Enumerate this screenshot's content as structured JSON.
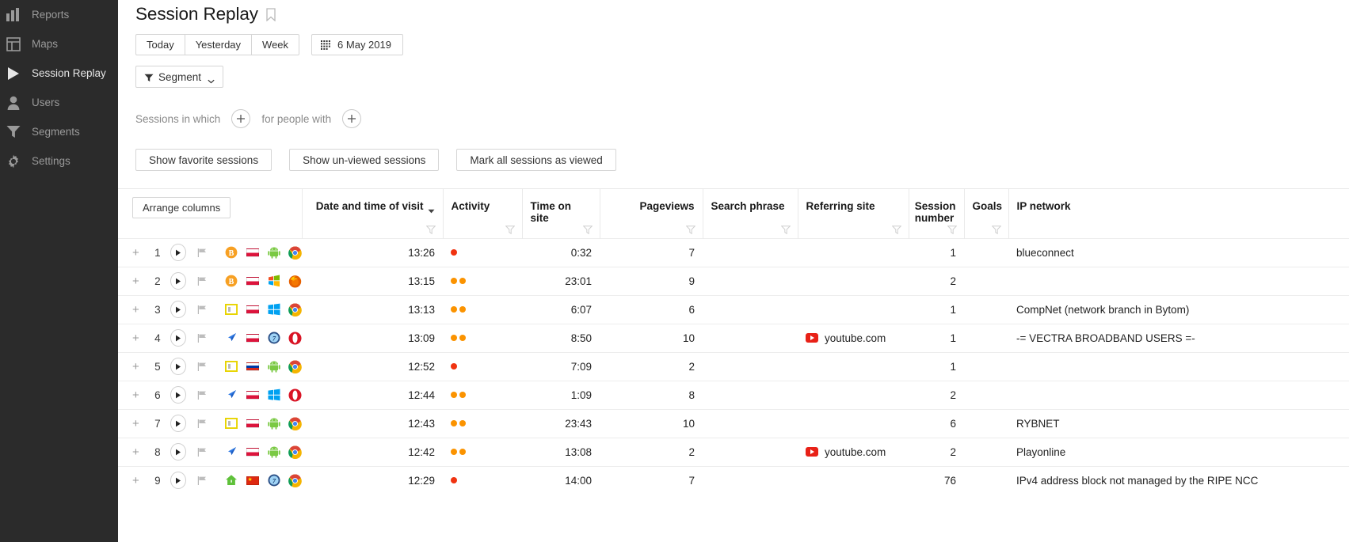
{
  "sidebar": {
    "items": [
      {
        "label": "Reports",
        "icon": "bar-chart-icon",
        "active": false
      },
      {
        "label": "Maps",
        "icon": "map-layout-icon",
        "active": false
      },
      {
        "label": "Session Replay",
        "icon": "play-triangle-icon",
        "active": true
      },
      {
        "label": "Users",
        "icon": "person-icon",
        "active": false
      },
      {
        "label": "Segments",
        "icon": "funnel-icon",
        "active": false
      },
      {
        "label": "Settings",
        "icon": "gear-icon",
        "active": false
      }
    ]
  },
  "header": {
    "title": "Session Replay",
    "bookmark_icon": "bookmark-icon",
    "period_buttons": [
      "Today",
      "Yesterday",
      "Week"
    ],
    "date_button": {
      "label": "6 May 2019",
      "icon": "calendar-grid-icon"
    },
    "segment_button": {
      "label": "Segment",
      "icon": "funnel-icon",
      "caret": "chevron-down-icon"
    }
  },
  "conditions": {
    "sessions_label": "Sessions in which",
    "people_label": "for people with",
    "add_icon": "plus-icon"
  },
  "actions": {
    "favorite": "Show favorite sessions",
    "unviewed": "Show un-viewed sessions",
    "mark_all": "Mark all sessions as viewed"
  },
  "table": {
    "arrange_columns": "Arrange columns",
    "columns": [
      {
        "key": "datetime",
        "label": "Date and time of visit",
        "sorted": true,
        "align": "right",
        "filter": true
      },
      {
        "key": "activity",
        "label": "Activity",
        "align": "left",
        "filter": true
      },
      {
        "key": "timeonsite",
        "label": "Time on site",
        "align": "right",
        "filter": true
      },
      {
        "key": "pageviews",
        "label": "Pageviews",
        "align": "right",
        "filter": true
      },
      {
        "key": "searchphrase",
        "label": "Search phrase",
        "align": "left",
        "filter": true
      },
      {
        "key": "referring",
        "label": "Referring site",
        "align": "left",
        "filter": true
      },
      {
        "key": "sessionnum",
        "label": "Session number",
        "align": "right",
        "filter": true
      },
      {
        "key": "goals",
        "label": "Goals",
        "align": "left",
        "filter": true
      },
      {
        "key": "ipnetwork",
        "label": "IP network",
        "align": "left",
        "filter": false
      }
    ],
    "rows": [
      {
        "n": "1",
        "currency": "bitcoin",
        "country": "pl",
        "os": "android",
        "browser": "chrome",
        "time": "13:26",
        "activity": [
          "red"
        ],
        "timeonsite": "0:32",
        "pageviews": "7",
        "search": "",
        "referrer": "",
        "session": "1",
        "goals": "",
        "ipnetwork": "blueconnect"
      },
      {
        "n": "2",
        "currency": "bitcoin",
        "country": "pl",
        "os": "winxp",
        "browser": "firefox",
        "time": "13:15",
        "activity": [
          "orange",
          "orange"
        ],
        "timeonsite": "23:01",
        "pageviews": "9",
        "search": "",
        "referrer": "",
        "session": "2",
        "goals": "",
        "ipnetwork": ""
      },
      {
        "n": "3",
        "currency": "window",
        "country": "pl",
        "os": "win10",
        "browser": "chrome",
        "time": "13:13",
        "activity": [
          "orange",
          "orange"
        ],
        "timeonsite": "6:07",
        "pageviews": "6",
        "search": "",
        "referrer": "",
        "session": "1",
        "goals": "",
        "ipnetwork": "CompNet (network branch in Bytom)"
      },
      {
        "n": "4",
        "currency": "arrow",
        "country": "pl",
        "os": "win7",
        "browser": "opera",
        "time": "13:09",
        "activity": [
          "orange",
          "orange"
        ],
        "timeonsite": "8:50",
        "pageviews": "10",
        "search": "",
        "referrer": "youtube.com",
        "session": "1",
        "goals": "",
        "ipnetwork": "-= VECTRA BROADBAND USERS =-"
      },
      {
        "n": "5",
        "currency": "window",
        "country": "ru",
        "os": "android",
        "browser": "chrome",
        "time": "12:52",
        "activity": [
          "red"
        ],
        "timeonsite": "7:09",
        "pageviews": "2",
        "search": "",
        "referrer": "",
        "session": "1",
        "goals": "",
        "ipnetwork": ""
      },
      {
        "n": "6",
        "currency": "arrow",
        "country": "pl",
        "os": "win10",
        "browser": "opera",
        "time": "12:44",
        "activity": [
          "orange",
          "orange"
        ],
        "timeonsite": "1:09",
        "pageviews": "8",
        "search": "",
        "referrer": "",
        "session": "2",
        "goals": "",
        "ipnetwork": ""
      },
      {
        "n": "7",
        "currency": "window",
        "country": "pl",
        "os": "android",
        "browser": "chrome",
        "time": "12:43",
        "activity": [
          "orange",
          "orange"
        ],
        "timeonsite": "23:43",
        "pageviews": "10",
        "search": "",
        "referrer": "",
        "session": "6",
        "goals": "",
        "ipnetwork": "RYBNET"
      },
      {
        "n": "8",
        "currency": "arrow",
        "country": "pl",
        "os": "android",
        "browser": "chrome",
        "time": "12:42",
        "activity": [
          "orange",
          "orange"
        ],
        "timeonsite": "13:08",
        "pageviews": "2",
        "search": "",
        "referrer": "youtube.com",
        "session": "2",
        "goals": "",
        "ipnetwork": "Playonline"
      },
      {
        "n": "9",
        "currency": "house",
        "country": "cn",
        "os": "win7",
        "browser": "chrome",
        "time": "12:29",
        "activity": [
          "red"
        ],
        "timeonsite": "14:00",
        "pageviews": "7",
        "search": "",
        "referrer": "",
        "session": "76",
        "goals": "",
        "ipnetwork": "IPv4 address block not managed by the RIPE NCC"
      }
    ]
  },
  "colors": {
    "sidebar_bg": "#2b2b2b",
    "activity_red": "#f03311",
    "activity_orange": "#fb9300",
    "youtube_red": "#e82117"
  }
}
